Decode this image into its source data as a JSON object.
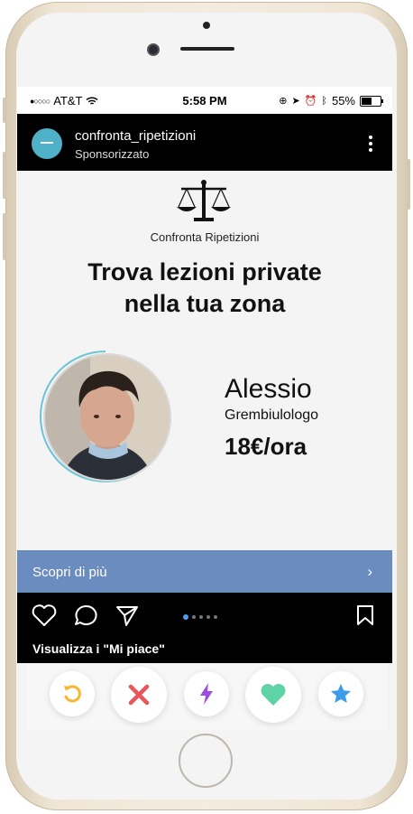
{
  "status_bar": {
    "carrier": "AT&T",
    "time": "5:58 PM",
    "battery": "55%"
  },
  "post": {
    "username": "confronta_ripetizioni",
    "sponsored": "Sponsorizzato"
  },
  "ad": {
    "brand": "Confronta Ripetizioni",
    "headline_line1": "Trova lezioni private",
    "headline_line2": "nella tua zona",
    "tutor_name": "Alessio",
    "tutor_role": "Grembiulologo",
    "tutor_price": "18€/ora"
  },
  "cta": {
    "label": "Scopri di più",
    "arrow": "›"
  },
  "actions": {
    "likes_label": "Visualizza i \"Mi piace\"",
    "carousel_pages": 5,
    "carousel_active": 1
  },
  "colors": {
    "cta": "#6a8cbf",
    "header": "#000000",
    "avatar": "#4fb1c7",
    "rewind": "#f5b82e",
    "nope": "#e8565c",
    "boost": "#9b4fe0",
    "like": "#5fd3a8",
    "superlike": "#3c9bea"
  },
  "icons": [
    "heart-icon",
    "comment-icon",
    "share-icon",
    "bookmark-icon",
    "rewind-icon",
    "nope-icon",
    "boost-icon",
    "like-icon",
    "superlike-icon",
    "scales-icon",
    "more-icon"
  ]
}
